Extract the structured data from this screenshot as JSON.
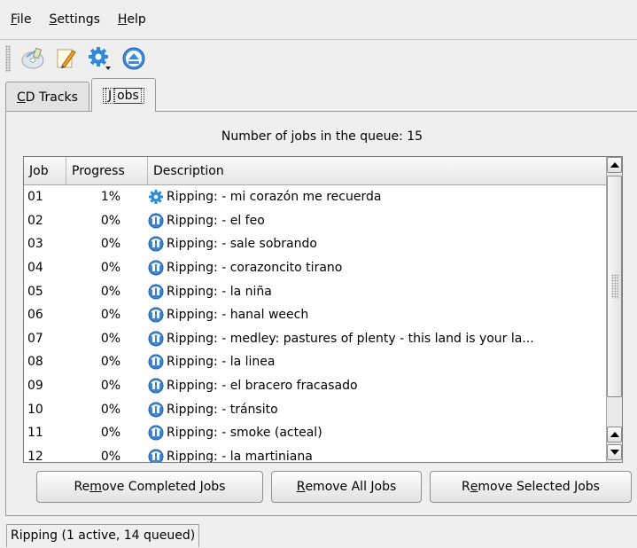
{
  "menu": {
    "file": {
      "prefix": "",
      "accel": "F",
      "rest": "ile"
    },
    "settings": {
      "prefix": "",
      "accel": "S",
      "rest": "ettings"
    },
    "help": {
      "prefix": "",
      "accel": "H",
      "rest": "elp"
    }
  },
  "toolbar": {
    "buttons": [
      {
        "icon": "cd-rip-icon"
      },
      {
        "icon": "edit-pencil-icon"
      },
      {
        "icon": "configure-gear-icon"
      },
      {
        "icon": "eject-icon"
      }
    ]
  },
  "tabs": [
    {
      "accel": "C",
      "rest": "D Tracks",
      "active": false
    },
    {
      "accel": "J",
      "rest": "obs",
      "active": true
    }
  ],
  "jobs_panel": {
    "queue_label": "Number of jobs in the queue: 15",
    "columns": [
      "Job",
      "Progress",
      "Description"
    ],
    "rows": [
      {
        "job": "01",
        "progress": "1%",
        "status": "active",
        "description": "Ripping:  - mi corazón me recuerda"
      },
      {
        "job": "02",
        "progress": "0%",
        "status": "queued",
        "description": "Ripping:  - el feo"
      },
      {
        "job": "03",
        "progress": "0%",
        "status": "queued",
        "description": "Ripping:  - sale sobrando"
      },
      {
        "job": "04",
        "progress": "0%",
        "status": "queued",
        "description": "Ripping:  - corazoncito tirano"
      },
      {
        "job": "05",
        "progress": "0%",
        "status": "queued",
        "description": "Ripping:  - la niña"
      },
      {
        "job": "06",
        "progress": "0%",
        "status": "queued",
        "description": "Ripping:  - hanal weech"
      },
      {
        "job": "07",
        "progress": "0%",
        "status": "queued",
        "description": "Ripping:  - medley: pastures of plenty - this land is your la..."
      },
      {
        "job": "08",
        "progress": "0%",
        "status": "queued",
        "description": "Ripping:  - la linea"
      },
      {
        "job": "09",
        "progress": "0%",
        "status": "queued",
        "description": "Ripping:  - el bracero fracasado"
      },
      {
        "job": "10",
        "progress": "0%",
        "status": "queued",
        "description": "Ripping:  - tránsito"
      },
      {
        "job": "11",
        "progress": "0%",
        "status": "queued",
        "description": "Ripping:  - smoke (acteal)"
      },
      {
        "job": "12",
        "progress": "0%",
        "status": "queued",
        "description": "Ripping:  - la martiniana"
      }
    ],
    "buttons": {
      "remove_completed": {
        "pre": "Re",
        "accel": "m",
        "post": "ove Completed Jobs"
      },
      "remove_all": {
        "pre": "",
        "accel": "R",
        "post": "emove All Jobs"
      },
      "remove_selected": {
        "pre": "R",
        "accel": "e",
        "post": "move Selected Jobs"
      }
    }
  },
  "statusbar": {
    "text": "Ripping (1 active, 14 queued)"
  },
  "colors": {
    "active_icon": "#2a8fd8",
    "queued_icon": "#3a86d4",
    "window_bg": "#efefef"
  }
}
